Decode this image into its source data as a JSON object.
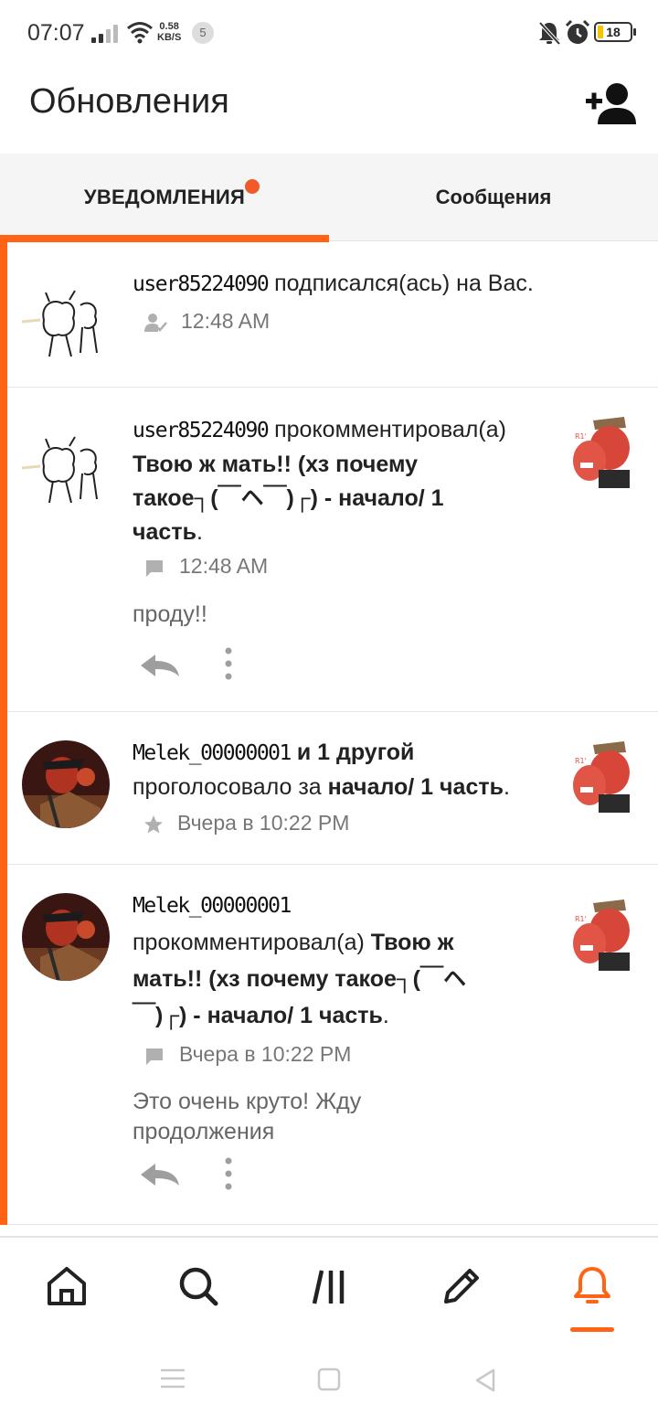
{
  "status_bar": {
    "time": "07:07",
    "net_speed_value": "0.58",
    "net_speed_unit": "KB/S",
    "notif_count": "5",
    "battery": "18"
  },
  "header": {
    "title": "Обновления"
  },
  "tabs": [
    {
      "label": "УВЕДОМЛЕНИЯ",
      "active": true,
      "has_dot": true
    },
    {
      "label": "Сообщения",
      "active": false
    }
  ],
  "notifications": [
    {
      "user": "user85224090",
      "action": " подписался(ась) на Вас.",
      "time": "12:48 AM",
      "meta_icon": "follow-icon"
    },
    {
      "user": "user85224090",
      "action": " прокомментировал(а)",
      "story_line1": "Твою ж мать!! (хз почему",
      "story_line2": "такое┐(￣ヘ￣)┌) - начало/ 1",
      "story_line3": "часть",
      "period": ".",
      "time": "12:48 AM",
      "meta_icon": "comment-icon",
      "comment": "проду!!"
    },
    {
      "user": "Melek_00000001",
      "and_others": " и 1 другой",
      "action": "проголосовало за ",
      "story": "начало/ 1 часть",
      "period": ".",
      "time": "Вчера в 10:22 PM",
      "meta_icon": "star-icon"
    },
    {
      "user": "Melek_00000001",
      "action": "прокомментировал(а) ",
      "story_line1": "Твою ж",
      "story_line2": "мать!! (хз почему такое┐(￣ヘ",
      "story_line3": "￣)┌) - начало/ 1 часть",
      "period": ".",
      "time": "Вчера в 10:22 PM",
      "meta_icon": "comment-icon",
      "comment_line1": "Это очень круто! Жду",
      "comment_line2": "продолжения"
    }
  ],
  "bottom_nav": [
    {
      "icon": "home-icon",
      "active": false
    },
    {
      "icon": "search-icon",
      "active": false
    },
    {
      "icon": "library-icon",
      "active": false
    },
    {
      "icon": "write-icon",
      "active": false
    },
    {
      "icon": "bell-icon",
      "active": true
    }
  ],
  "colors": {
    "accent": "#ff6313",
    "dot": "#f25a2c"
  }
}
